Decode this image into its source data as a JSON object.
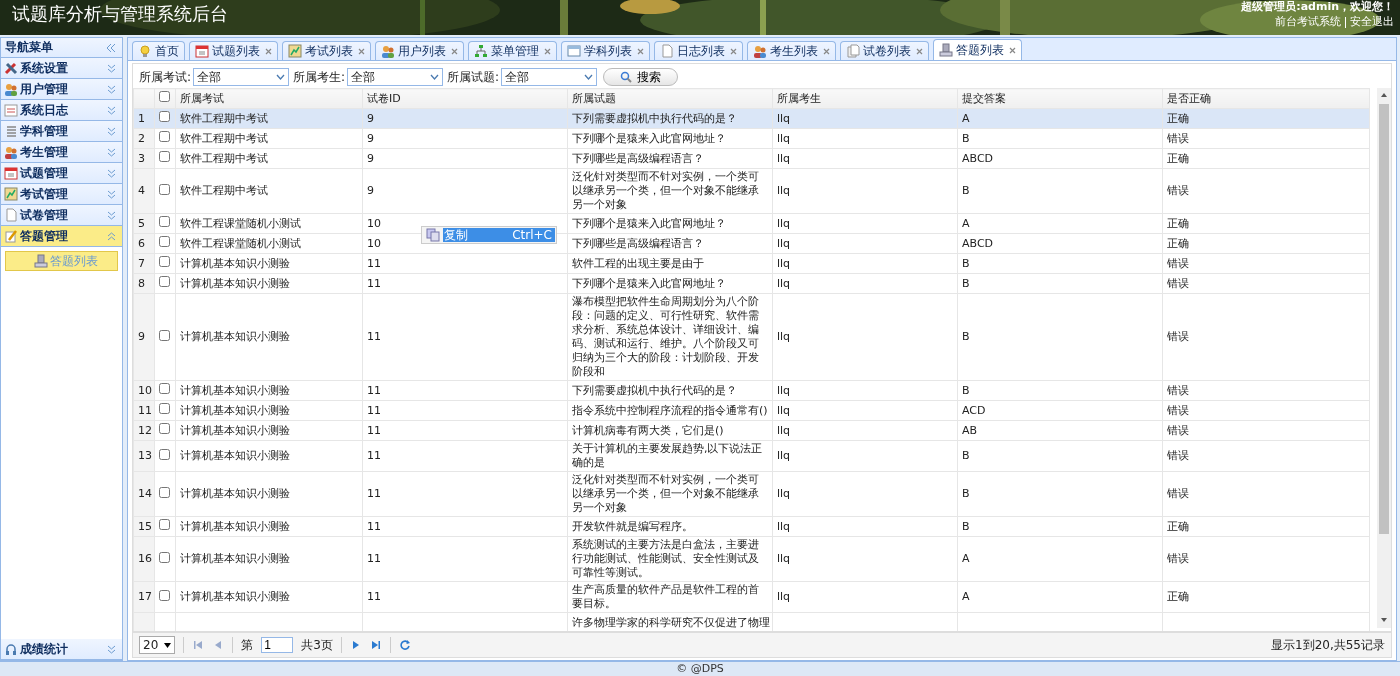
{
  "header": {
    "title": "试题库分析与管理系统后台",
    "greeting": "超级管理员:admin，欢迎您！",
    "links": [
      "前台考试系统",
      "安全退出"
    ]
  },
  "sidebar": {
    "title": "导航菜单",
    "groups": [
      {
        "label": "系统设置",
        "expanded": false
      },
      {
        "label": "用户管理",
        "expanded": false
      },
      {
        "label": "系统日志",
        "expanded": false
      },
      {
        "label": "学科管理",
        "expanded": false
      },
      {
        "label": "考生管理",
        "expanded": false
      },
      {
        "label": "试题管理",
        "expanded": false
      },
      {
        "label": "考试管理",
        "expanded": false
      },
      {
        "label": "试卷管理",
        "expanded": false
      },
      {
        "label": "答题管理",
        "expanded": true,
        "children": [
          {
            "label": "答题列表",
            "selected": true
          }
        ]
      }
    ],
    "bottom_group": {
      "label": "成绩统计",
      "expanded": false
    }
  },
  "tabs": [
    {
      "label": "首页",
      "selected": false,
      "closable": false
    },
    {
      "label": "试题列表",
      "selected": false,
      "closable": true
    },
    {
      "label": "考试列表",
      "selected": false,
      "closable": true
    },
    {
      "label": "用户列表",
      "selected": false,
      "closable": true
    },
    {
      "label": "菜单管理",
      "selected": false,
      "closable": true
    },
    {
      "label": "学科列表",
      "selected": false,
      "closable": true
    },
    {
      "label": "日志列表",
      "selected": false,
      "closable": true
    },
    {
      "label": "考生列表",
      "selected": false,
      "closable": true
    },
    {
      "label": "试卷列表",
      "selected": false,
      "closable": true
    },
    {
      "label": "答题列表",
      "selected": true,
      "closable": true
    }
  ],
  "filters": [
    {
      "label": "所属考试:",
      "value": "全部"
    },
    {
      "label": "所属考生:",
      "value": "全部"
    },
    {
      "label": "所属试题:",
      "value": "全部"
    }
  ],
  "search_button": "搜索",
  "table": {
    "select_all_checked": false,
    "columns": [
      "所属考试",
      "试卷ID",
      "所属试题",
      "所属考生",
      "提交答案",
      "是否正确"
    ],
    "rows": [
      {
        "number": "1",
        "checked": false,
        "selected": true,
        "cells": [
          "软件工程期中考试",
          "9",
          "下列需要虚拟机中执行代码的是？",
          "llq",
          "A",
          "正确"
        ]
      },
      {
        "number": "2",
        "checked": false,
        "selected": false,
        "cells": [
          "软件工程期中考试",
          "9",
          "下列哪个是猿来入此官网地址？",
          "llq",
          "B",
          "错误"
        ]
      },
      {
        "number": "3",
        "checked": false,
        "selected": false,
        "cells": [
          "软件工程期中考试",
          "9",
          "下列哪些是高级编程语言？",
          "llq",
          "ABCD",
          "正确"
        ]
      },
      {
        "number": "4",
        "checked": false,
        "selected": false,
        "cells": [
          "软件工程期中考试",
          "9",
          "泛化针对类型而不针对实例，一个类可以继承另一个类，但一个对象不能继承另一个对象",
          "llq",
          "B",
          "错误"
        ]
      },
      {
        "number": "5",
        "checked": false,
        "selected": false,
        "cells": [
          "软件工程课堂随机小测试",
          "10",
          "下列哪个是猿来入此官网地址？",
          "llq",
          "A",
          "正确"
        ]
      },
      {
        "number": "6",
        "checked": false,
        "selected": false,
        "cells": [
          "软件工程课堂随机小测试",
          "10",
          "下列哪些是高级编程语言？",
          "llq",
          "ABCD",
          "正确"
        ]
      },
      {
        "number": "7",
        "checked": false,
        "selected": false,
        "cells": [
          "计算机基本知识小测验",
          "11",
          "软件工程的出现主要是由于",
          "llq",
          "B",
          "错误"
        ]
      },
      {
        "number": "8",
        "checked": false,
        "selected": false,
        "cells": [
          "计算机基本知识小测验",
          "11",
          "下列哪个是猿来入此官网地址？",
          "llq",
          "B",
          "错误"
        ]
      },
      {
        "number": "9",
        "checked": false,
        "selected": false,
        "cells": [
          "计算机基本知识小测验",
          "11",
          "瀑布模型把软件生命周期划分为八个阶段：问题的定义、可行性研究、软件需求分析、系统总体设计、详细设计、编码、测试和运行、维护。八个阶段又可归纳为三个大的阶段：计划阶段、开发阶段和",
          "llq",
          "B",
          "错误"
        ]
      },
      {
        "number": "10",
        "checked": false,
        "selected": false,
        "cells": [
          "计算机基本知识小测验",
          "11",
          "下列需要虚拟机中执行代码的是？",
          "llq",
          "B",
          "错误"
        ]
      },
      {
        "number": "11",
        "checked": false,
        "selected": false,
        "cells": [
          "计算机基本知识小测验",
          "11",
          "指令系统中控制程序流程的指令通常有()",
          "llq",
          "ACD",
          "错误"
        ]
      },
      {
        "number": "12",
        "checked": false,
        "selected": false,
        "cells": [
          "计算机基本知识小测验",
          "11",
          "计算机病毒有两大类，它们是()",
          "llq",
          "AB",
          "错误"
        ]
      },
      {
        "number": "13",
        "checked": false,
        "selected": false,
        "cells": [
          "计算机基本知识小测验",
          "11",
          "关于计算机的主要发展趋势,以下说法正确的是",
          "llq",
          "B",
          "错误"
        ]
      },
      {
        "number": "14",
        "checked": false,
        "selected": false,
        "cells": [
          "计算机基本知识小测验",
          "11",
          "泛化针对类型而不针对实例，一个类可以继承另一个类，但一个对象不能继承另一个对象",
          "llq",
          "B",
          "错误"
        ]
      },
      {
        "number": "15",
        "checked": false,
        "selected": false,
        "cells": [
          "计算机基本知识小测验",
          "11",
          "开发软件就是编写程序。",
          "llq",
          "B",
          "正确"
        ]
      },
      {
        "number": "16",
        "checked": false,
        "selected": false,
        "cells": [
          "计算机基本知识小测验",
          "11",
          "系统测试的主要方法是白盒法，主要进行功能测试、性能测试、安全性测试及可靠性等测试。",
          "llq",
          "A",
          "错误"
        ]
      },
      {
        "number": "17",
        "checked": false,
        "selected": false,
        "cells": [
          "计算机基本知识小测验",
          "11",
          "生产高质量的软件产品是软件工程的首要目标。",
          "llq",
          "A",
          "正确"
        ]
      },
      {
        "cells": [
          "",
          "",
          "许多物理学家的科学研究不仅促进了物理",
          "",
          "",
          ""
        ]
      }
    ]
  },
  "context_menu": {
    "items": [
      {
        "label": "复制",
        "shortcut": "Ctrl+C",
        "selected": true
      }
    ]
  },
  "pager": {
    "page_size": "20",
    "page_label": "第",
    "page": "1",
    "total_pages": "共3页",
    "summary": "显示1到20,共55记录"
  },
  "footer": "© @DPS"
}
